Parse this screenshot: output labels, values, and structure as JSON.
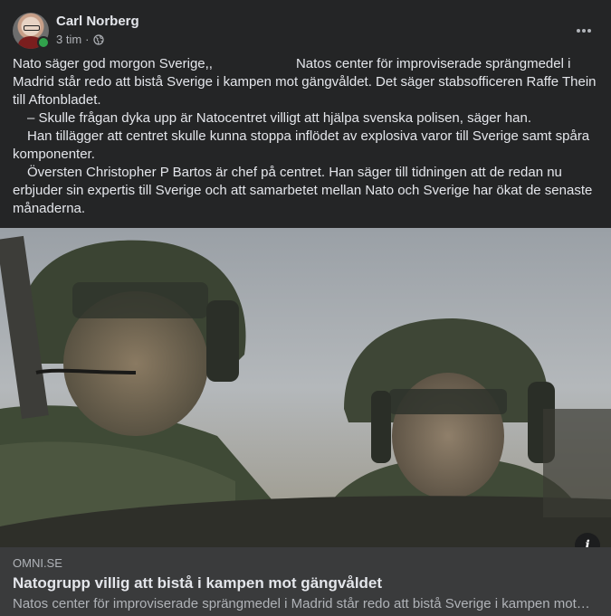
{
  "post": {
    "author": "Carl Norberg",
    "time": "3 tim",
    "separator": "·",
    "privacy_icon": "globe-icon",
    "more_icon": "more-horizontal-icon",
    "text": {
      "line1_a": "Nato säger god morgon Sverige,,",
      "line1_b": "Natos center för improviserade sprängmedel i Madrid står redo att bistå Sverige i kampen mot gängvåldet. Det säger stabsofficeren Raffe Thein till Aftonbladet.",
      "p2": "– Skulle frågan dyka upp är Natocentret villigt att hjälpa svenska polisen, säger han.",
      "p3": "Han tillägger att centret skulle kunna stoppa inflödet av explosiva varor till Sverige samt spåra komponenter.",
      "p4": "Översten Christopher P Bartos är chef på centret. Han säger till tidningen att de redan nu erbjuder sin expertis till Sverige och att samarbetet mellan Nato och Sverige har ökat de senaste månaderna."
    }
  },
  "link": {
    "domain": "OMNI.SE",
    "title": "Natogrupp villig att bistå i kampen mot gängvåldet",
    "description": "Natos center för improviserade sprängmedel i Madrid står redo att bistå Sverige i kampen mot gängvåldet.",
    "info_label": "i",
    "image_icon": "soldiers-photo"
  },
  "colors": {
    "background": "#242526",
    "text": "#e4e6eb",
    "secondary": "#b0b3b8",
    "online": "#31a24c",
    "footer": "#3a3b3c"
  }
}
